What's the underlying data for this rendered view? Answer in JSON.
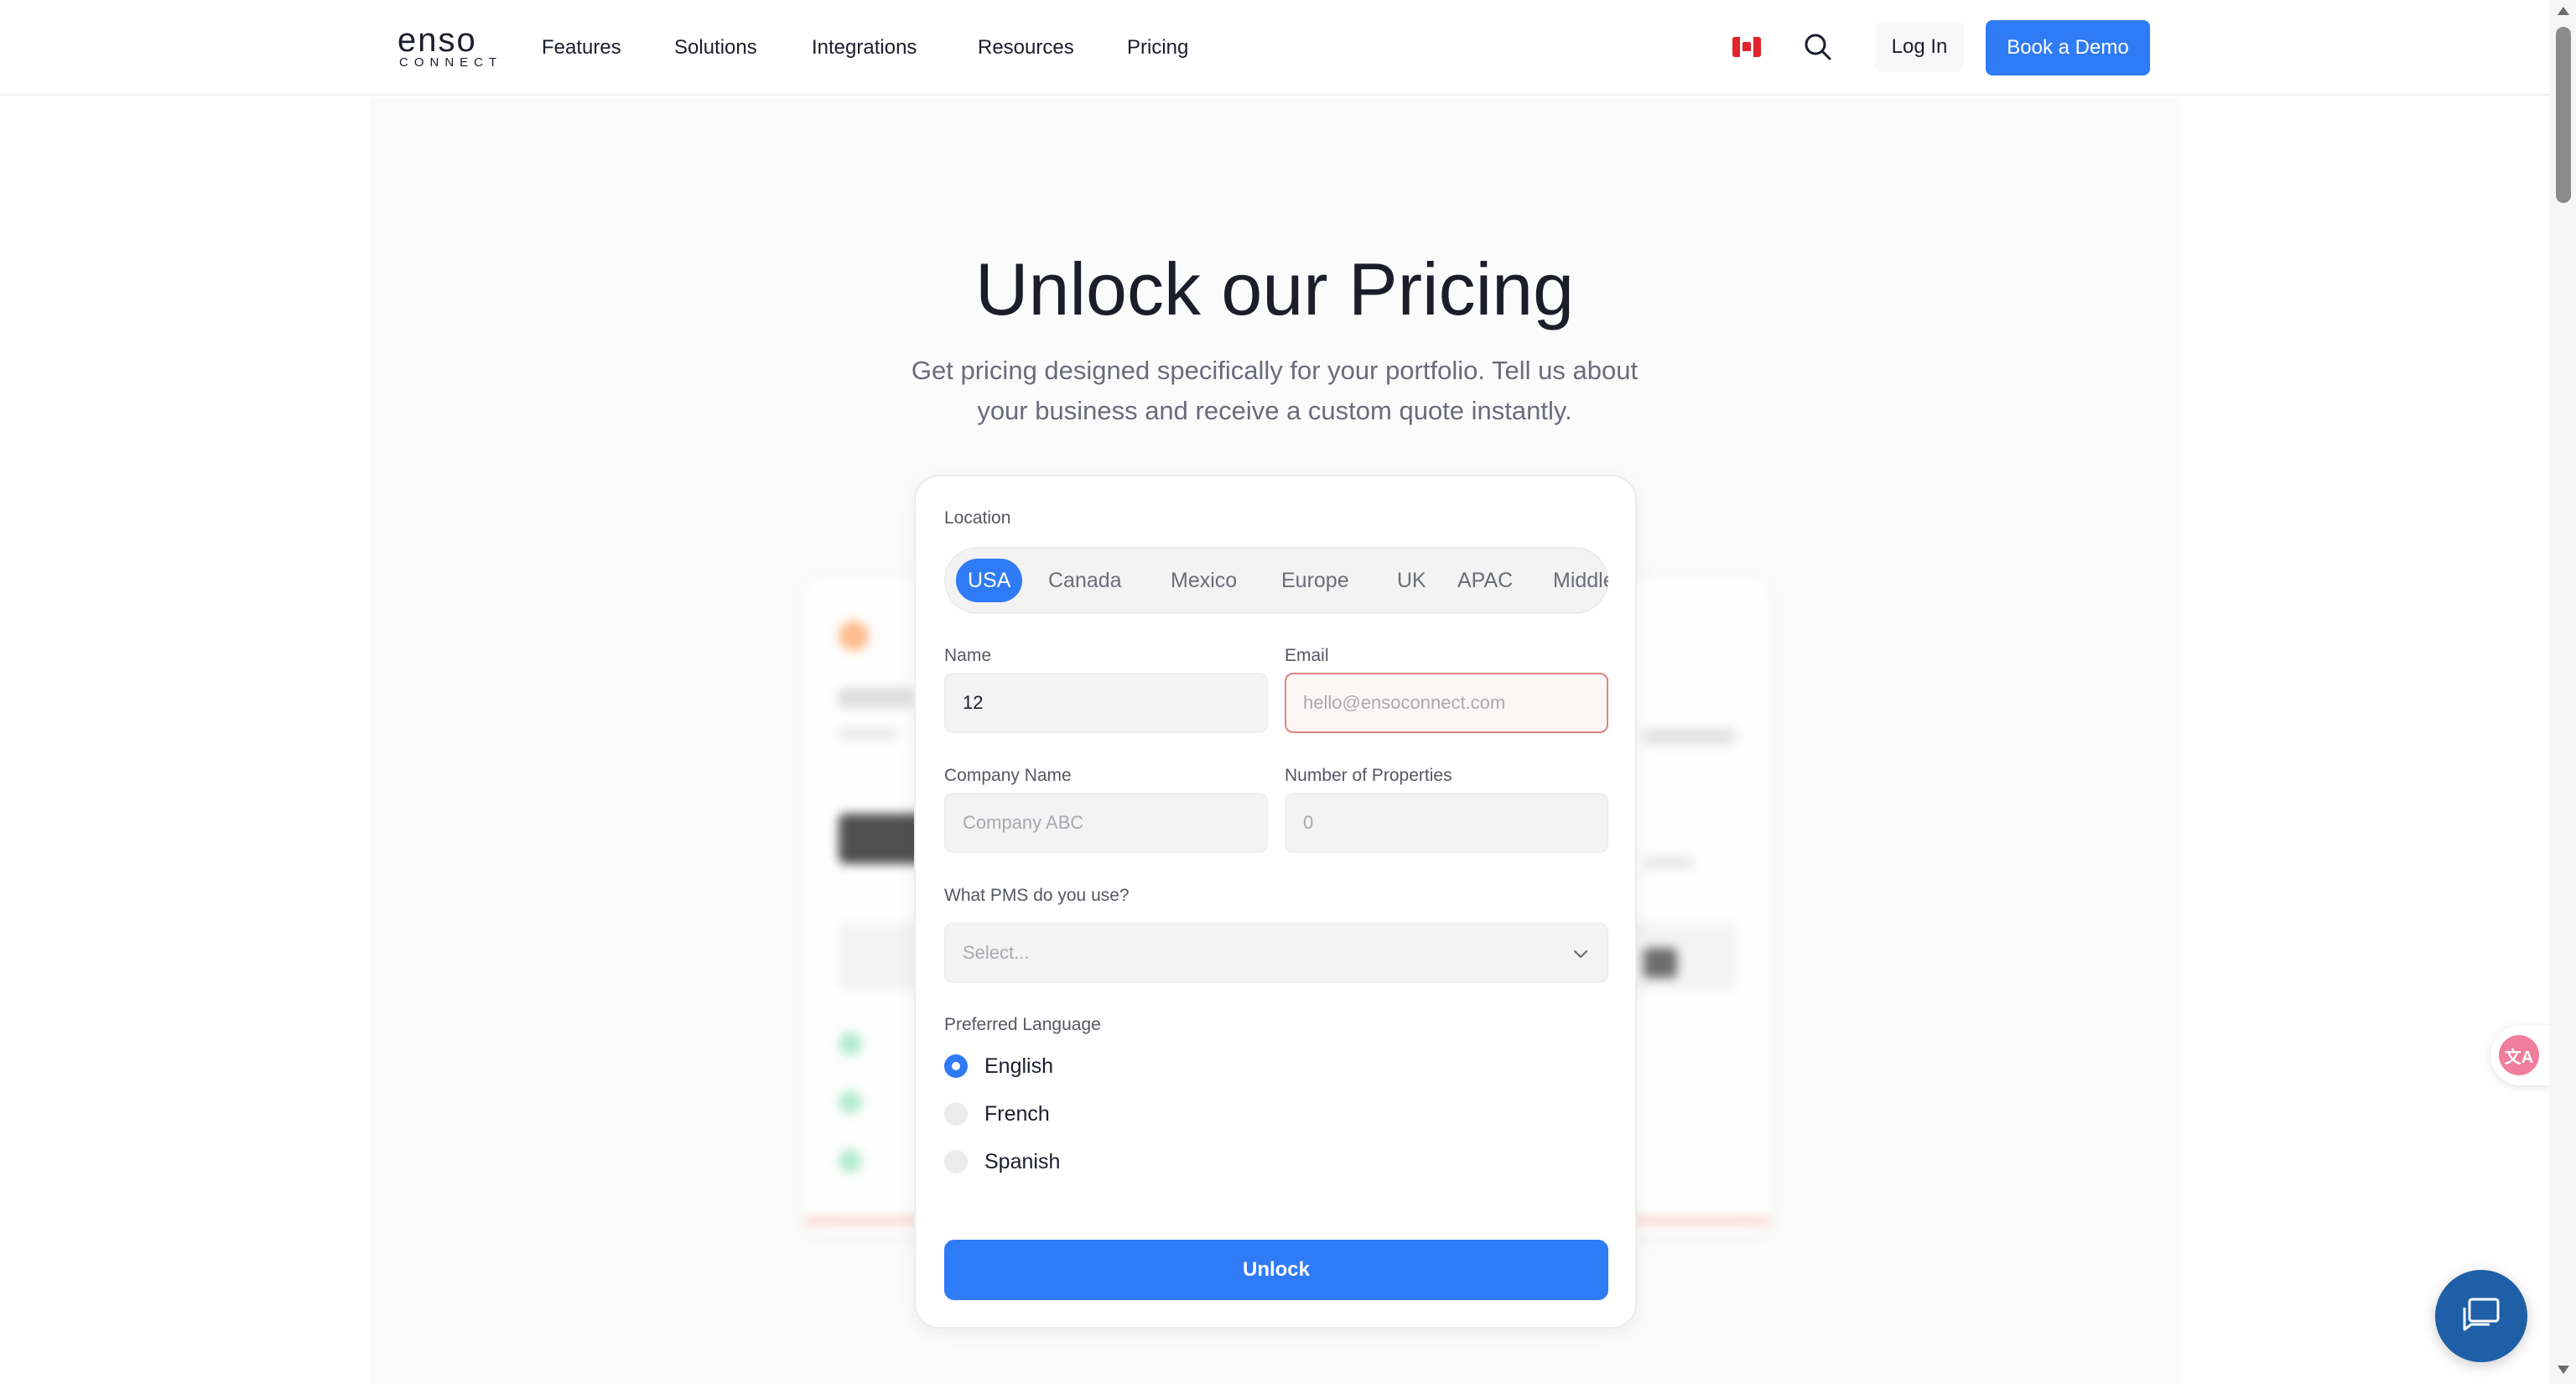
{
  "header": {
    "logo_word": "enso",
    "logo_sub": "CONNECT",
    "nav": [
      "Features",
      "Solutions",
      "Integrations",
      "Resources",
      "Pricing"
    ],
    "login_label": "Log In",
    "demo_label": "Book a Demo"
  },
  "hero": {
    "title": "Unlock our Pricing",
    "subtitle": "Get pricing designed specifically for your portfolio. Tell us about your business and receive a custom quote instantly."
  },
  "form": {
    "location_label": "Location",
    "locations": [
      "USA",
      "Canada",
      "Mexico",
      "Europe",
      "UK",
      "APAC",
      "Middle"
    ],
    "active_location": "USA",
    "name_label": "Name",
    "name_value": "12",
    "email_label": "Email",
    "email_placeholder": "hello@ensoconnect.com",
    "company_label": "Company Name",
    "company_placeholder": "Company ABC",
    "properties_label": "Number of Properties",
    "properties_placeholder": "0",
    "pms_label": "What PMS do you use?",
    "pms_placeholder": "Select...",
    "language_label": "Preferred Language",
    "languages": [
      "English",
      "French",
      "Spanish"
    ],
    "selected_language": "English",
    "submit_label": "Unlock"
  },
  "widgets": {
    "translate_glyph": "文A"
  },
  "colors": {
    "accent": "#2f7bf5",
    "chat": "#1f5fa8",
    "error_border": "#e0857e"
  }
}
